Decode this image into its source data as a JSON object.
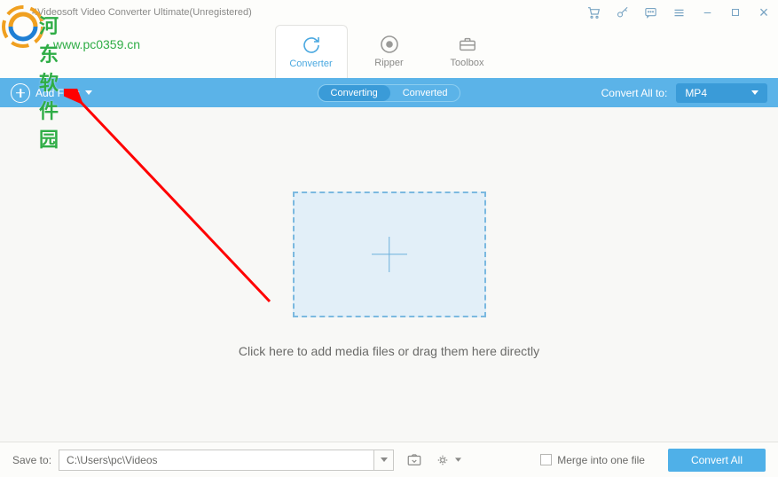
{
  "app": {
    "title": "4Videosoft Video Converter Ultimate(Unregistered)"
  },
  "nav": {
    "tabs": [
      {
        "label": "Converter",
        "icon": "refresh-icon",
        "active": true
      },
      {
        "label": "Ripper",
        "icon": "record-icon",
        "active": false
      },
      {
        "label": "Toolbox",
        "icon": "toolbox-icon",
        "active": false
      }
    ]
  },
  "action_bar": {
    "add_files_label": "Add Files",
    "center_tabs": {
      "converting": "Converting",
      "converted": "Converted"
    },
    "convert_all_label": "Convert All to:",
    "convert_all_value": "MP4"
  },
  "content": {
    "drop_text": "Click here to add media files or drag them here directly"
  },
  "footer": {
    "save_to_label": "Save to:",
    "save_path": "C:\\Users\\pc\\Videos",
    "merge_label": "Merge into one file",
    "convert_all_btn": "Convert All"
  },
  "watermark": {
    "title": "河东软件园",
    "url": "www.pc0359.cn"
  }
}
